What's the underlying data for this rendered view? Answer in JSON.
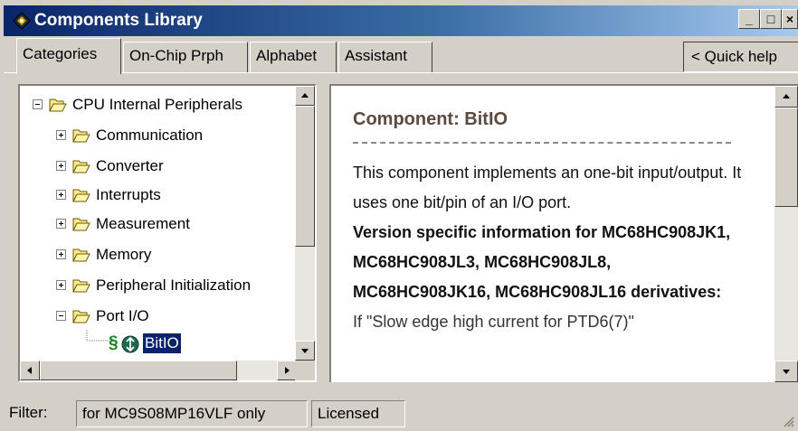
{
  "window": {
    "title": "Components Library",
    "minimize_glyph": "_",
    "maximize_glyph": "□",
    "close_glyph": "×"
  },
  "tabs": [
    {
      "label": "Categories",
      "active": true
    },
    {
      "label": "On-Chip Prph",
      "active": false
    },
    {
      "label": "Alphabet",
      "active": false
    },
    {
      "label": "Assistant",
      "active": false
    }
  ],
  "quick_help_button": "< Quick help",
  "tree": {
    "root": {
      "label": "CPU Internal Peripherals",
      "expanded": true,
      "icon": "folder-open-icon"
    },
    "children": [
      {
        "label": "Communication",
        "expanded": false,
        "icon": "folder-open-icon"
      },
      {
        "label": "Converter",
        "expanded": false,
        "icon": "folder-open-icon"
      },
      {
        "label": "Interrupts",
        "expanded": false,
        "icon": "folder-open-icon"
      },
      {
        "label": "Measurement",
        "expanded": false,
        "icon": "folder-open-icon"
      },
      {
        "label": "Memory",
        "expanded": false,
        "icon": "folder-open-icon"
      },
      {
        "label": "Peripheral Initialization",
        "expanded": false,
        "icon": "folder-open-icon"
      },
      {
        "label": "Port I/O",
        "expanded": true,
        "icon": "folder-open-icon"
      }
    ],
    "leaf": {
      "label": "BitIO",
      "selected": true,
      "icons": [
        "script-s-icon",
        "component-globe-icon"
      ]
    }
  },
  "help": {
    "title": "Component: BitIO",
    "paragraph": "This component implements an one-bit input/output. It uses one bit/pin of an I/O port.",
    "version_heading": "Version specific information for MC68HC908JK1, MC68HC908JL3, MC68HC908JL8, MC68HC908JK16, MC68HC908JL16 derivatives:",
    "cut_line": "If \"Slow edge high current for PTD6(7)\""
  },
  "status": {
    "filter_label": "Filter:",
    "filter_value": "for MC9S08MP16VLF only",
    "license": "Licensed"
  },
  "colors": {
    "title_gradient_start": "#0a246a",
    "title_gradient_end": "#a6caf0",
    "help_title": "#5a4a40",
    "selection": "#0a246a",
    "folder_outline": "#6b5a00"
  }
}
